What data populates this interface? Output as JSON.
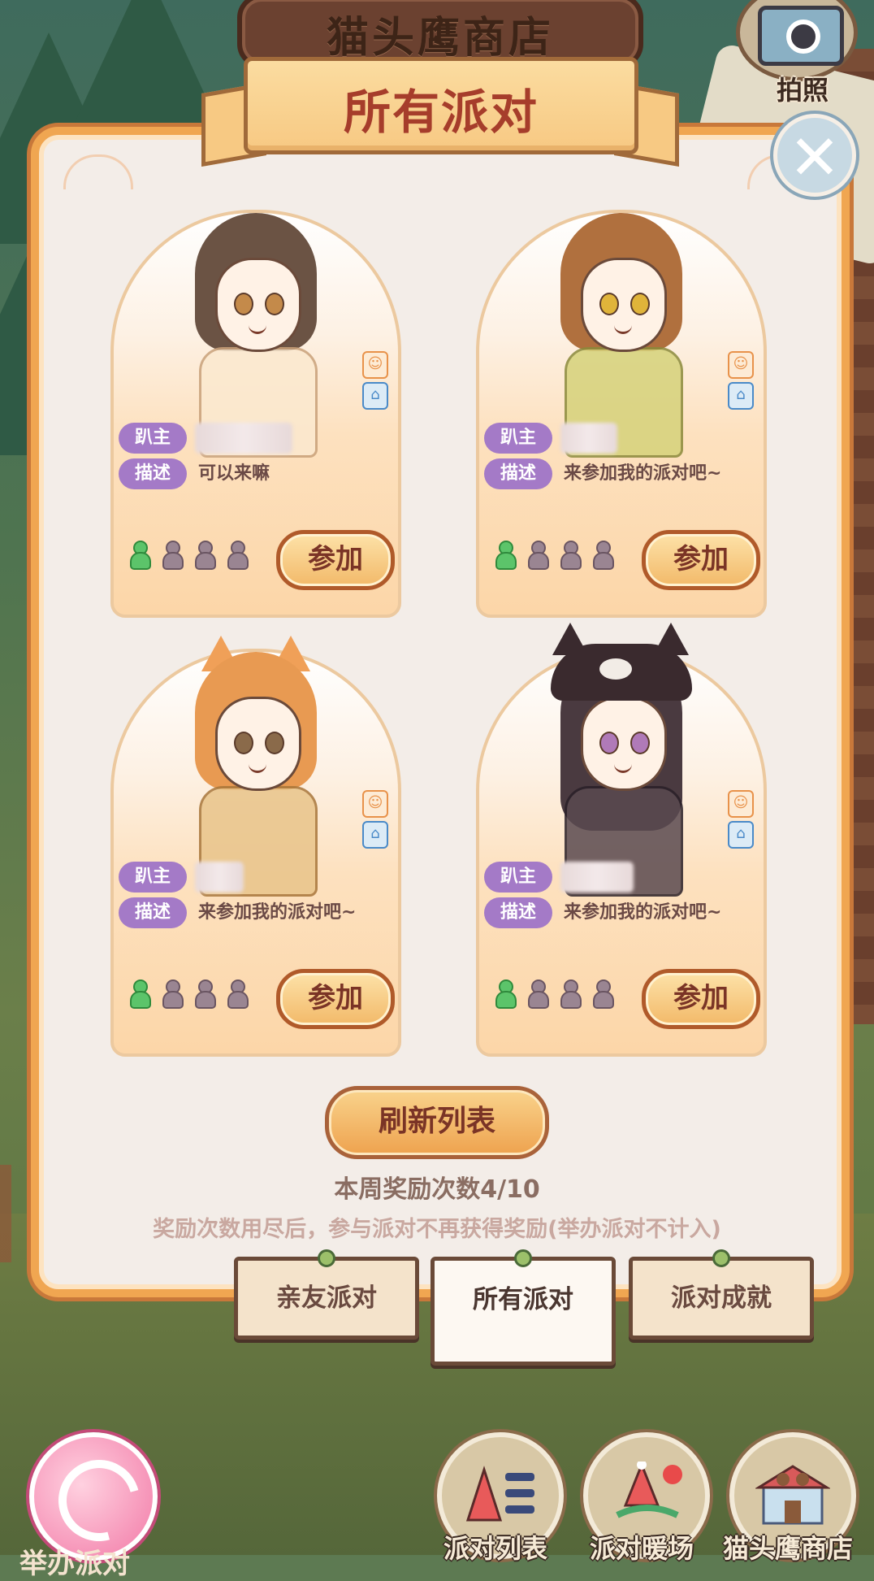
{
  "shop_banner": {
    "title": "猫头鹰商店"
  },
  "camera": {
    "label": "拍照"
  },
  "panel": {
    "title": "所有派对"
  },
  "cards": [
    {
      "host_label": "趴主",
      "desc_label": "描述",
      "description": "可以来嘛",
      "join_label": "参加",
      "members": 1,
      "capacity": 4
    },
    {
      "host_label": "趴主",
      "desc_label": "描述",
      "description": "来参加我的派对吧~",
      "join_label": "参加",
      "members": 1,
      "capacity": 4
    },
    {
      "host_label": "趴主",
      "desc_label": "描述",
      "description": "来参加我的派对吧~",
      "join_label": "参加",
      "members": 1,
      "capacity": 4
    },
    {
      "host_label": "趴主",
      "desc_label": "描述",
      "description": "来参加我的派对吧~",
      "join_label": "参加",
      "members": 1,
      "capacity": 4
    }
  ],
  "refresh_label": "刷新列表",
  "reward_count": "本周奖励次数4/10",
  "reward_note": "奖励次数用尽后，参与派对不再获得奖励(举办派对不计入)",
  "tabs": [
    {
      "label": "亲友派对",
      "active": false
    },
    {
      "label": "所有派对",
      "active": true
    },
    {
      "label": "派对成就",
      "active": false
    }
  ],
  "bottom_nav": {
    "side_label": "举办派对",
    "items": [
      {
        "label": "派对列表",
        "icon": "party-list-icon"
      },
      {
        "label": "派对暖场",
        "icon": "party-warmup-icon"
      },
      {
        "label": "猫头鹰商店",
        "icon": "owl-shop-icon"
      }
    ]
  },
  "colors": {
    "panel_border": "#f0a651",
    "title_text": "#a63d2b",
    "pill": "#a47ac7",
    "slot_on": "#5cc46a",
    "slot_off": "#9a8592"
  }
}
